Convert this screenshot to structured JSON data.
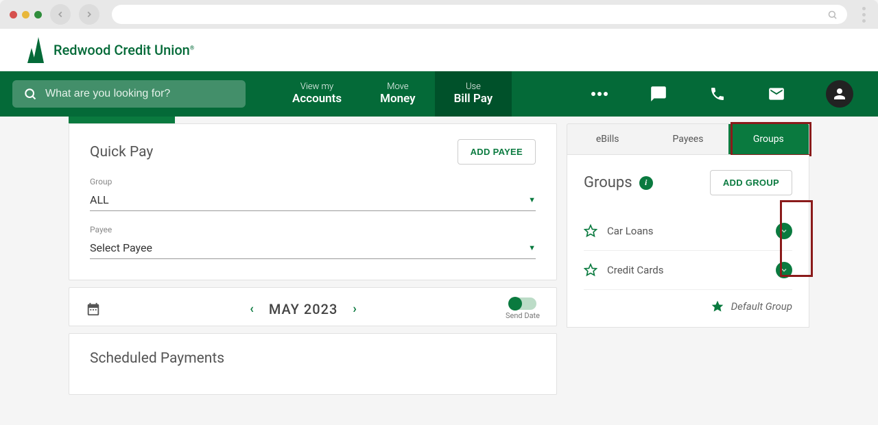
{
  "browser": {
    "search_placeholder": ""
  },
  "logo": {
    "text": "Redwood Credit Union"
  },
  "nav": {
    "search_placeholder": "What are you looking for?",
    "items": [
      {
        "top": "View my",
        "bot": "Accounts"
      },
      {
        "top": "Move",
        "bot": "Money"
      },
      {
        "top": "Use",
        "bot": "Bill Pay"
      }
    ]
  },
  "quickpay": {
    "title": "Quick Pay",
    "add_payee": "ADD PAYEE",
    "group_label": "Group",
    "group_value": "ALL",
    "payee_label": "Payee",
    "payee_value": "Select Payee"
  },
  "monthbar": {
    "month": "MAY 2023",
    "toggle_label": "Send Date"
  },
  "scheduled": {
    "title": "Scheduled Payments"
  },
  "side": {
    "tabs": [
      "eBills",
      "Payees",
      "Groups"
    ],
    "groups_title": "Groups",
    "add_group": "ADD GROUP",
    "items": [
      {
        "name": "Car Loans"
      },
      {
        "name": "Credit Cards"
      }
    ],
    "default_label": "Default Group"
  }
}
